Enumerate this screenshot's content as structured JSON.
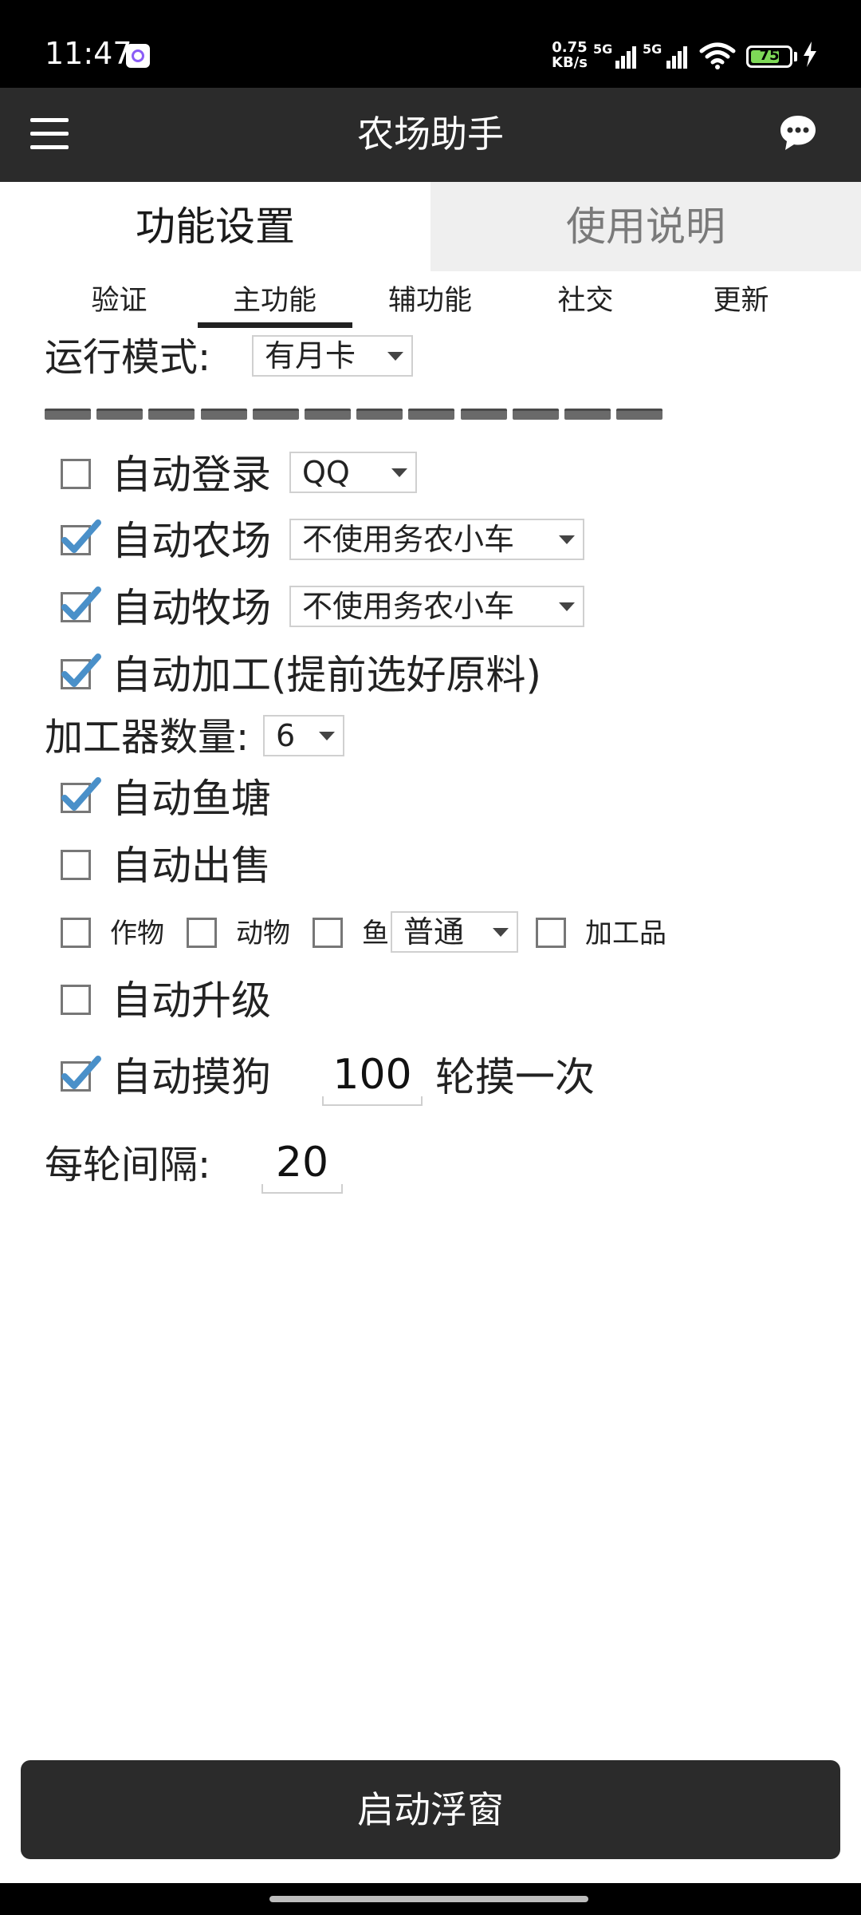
{
  "status": {
    "time": "11:47",
    "speed_value": "0.75",
    "speed_unit": "KB/s",
    "net1": "5G",
    "net2": "5G",
    "battery": "75",
    "battery_level_percent": 75
  },
  "app": {
    "title": "农场助手"
  },
  "main_tabs": [
    {
      "label": "功能设置",
      "active": true
    },
    {
      "label": "使用说明",
      "active": false
    }
  ],
  "sub_tabs": [
    {
      "label": "验证"
    },
    {
      "label": "主功能",
      "active": true
    },
    {
      "label": "辅功能"
    },
    {
      "label": "社交"
    },
    {
      "label": "更新"
    }
  ],
  "run_mode": {
    "label": "运行模式:",
    "value": "有月卡"
  },
  "progress_segments": 12,
  "options": {
    "auto_login": {
      "label": "自动登录",
      "checked": false,
      "select": "QQ"
    },
    "auto_farm": {
      "label": "自动农场",
      "checked": true,
      "select": "不使用务农小车"
    },
    "auto_ranch": {
      "label": "自动牧场",
      "checked": true,
      "select": "不使用务农小车"
    },
    "auto_process": {
      "label": "自动加工(提前选好原料)",
      "checked": true
    },
    "processor_count": {
      "label": "加工器数量:",
      "value": "6"
    },
    "auto_fishpond": {
      "label": "自动鱼塘",
      "checked": true
    },
    "auto_sell": {
      "label": "自动出售",
      "checked": false
    },
    "sell_crops": {
      "label": "作物",
      "checked": false
    },
    "sell_animals": {
      "label": "动物",
      "checked": false
    },
    "sell_fish": {
      "label": "鱼",
      "checked": false,
      "select": "普通"
    },
    "sell_processed": {
      "label": "加工品",
      "checked": false
    },
    "auto_upgrade": {
      "label": "自动升级",
      "checked": false
    },
    "auto_pet_dog": {
      "label": "自动摸狗",
      "checked": true,
      "rounds": "100",
      "suffix": "轮摸一次"
    },
    "interval": {
      "label": "每轮间隔:",
      "value": "20"
    }
  },
  "start_button": {
    "label": "启动浮窗"
  }
}
